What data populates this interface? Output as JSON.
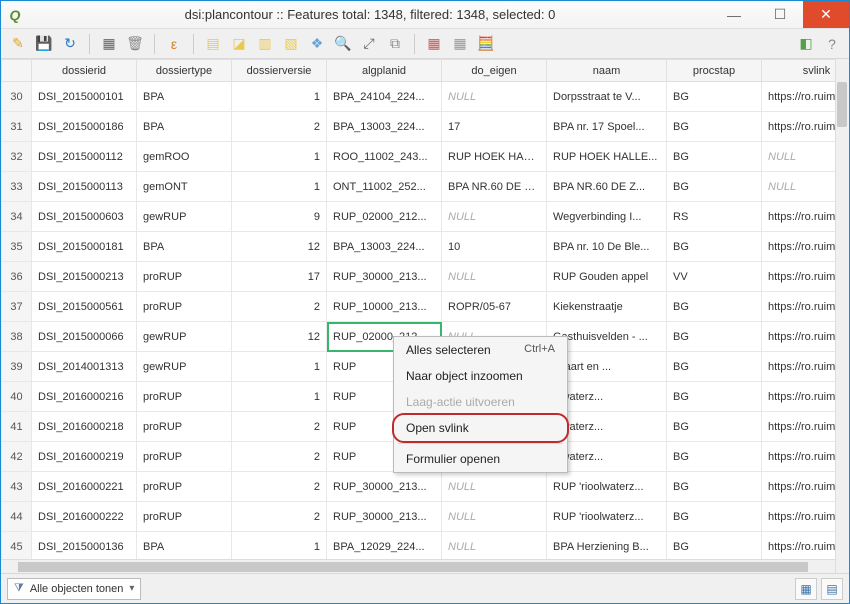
{
  "window": {
    "title": "dsi:plancontour :: Features total: 1348, filtered: 1348, selected: 0"
  },
  "columns": [
    "dossierid",
    "dossiertype",
    "dossierversie",
    "algplanid",
    "do_eigen",
    "naam",
    "procstap",
    "svlink"
  ],
  "rows": [
    {
      "n": "30",
      "dossierid": "DSI_2015000101",
      "dossiertype": "BPA",
      "dossierversie": "1",
      "algplanid": "BPA_24104_224...",
      "do_eigen": "NULL",
      "naam": "Dorpsstraat te V...",
      "procstap": "BG",
      "svlink": "https://ro.ruimte"
    },
    {
      "n": "31",
      "dossierid": "DSI_2015000186",
      "dossiertype": "BPA",
      "dossierversie": "2",
      "algplanid": "BPA_13003_224...",
      "do_eigen": "17",
      "naam": "BPA nr. 17 Spoel...",
      "procstap": "BG",
      "svlink": "https://ro.ruimte"
    },
    {
      "n": "32",
      "dossierid": "DSI_2015000112",
      "dossiertype": "gemROO",
      "dossierversie": "1",
      "algplanid": "ROO_11002_243...",
      "do_eigen": "RUP HOEK HALLE...",
      "naam": "RUP HOEK HALLE...",
      "procstap": "BG",
      "svlink": "NULL"
    },
    {
      "n": "33",
      "dossierid": "DSI_2015000113",
      "dossiertype": "gemONT",
      "dossierversie": "1",
      "algplanid": "ONT_11002_252...",
      "do_eigen": "BPA NR.60 DE Z...",
      "naam": "BPA NR.60 DE Z...",
      "procstap": "BG",
      "svlink": "NULL"
    },
    {
      "n": "34",
      "dossierid": "DSI_2015000603",
      "dossiertype": "gewRUP",
      "dossierversie": "9",
      "algplanid": "RUP_02000_212...",
      "do_eigen": "NULL",
      "naam": "Wegverbinding I...",
      "procstap": "RS",
      "svlink": "https://ro.ruimte"
    },
    {
      "n": "35",
      "dossierid": "DSI_2015000181",
      "dossiertype": "BPA",
      "dossierversie": "12",
      "algplanid": "BPA_13003_224...",
      "do_eigen": "10",
      "naam": "BPA nr. 10 De Ble...",
      "procstap": "BG",
      "svlink": "https://ro.ruimte"
    },
    {
      "n": "36",
      "dossierid": "DSI_2015000213",
      "dossiertype": "proRUP",
      "dossierversie": "17",
      "algplanid": "RUP_30000_213...",
      "do_eigen": "NULL",
      "naam": "RUP Gouden appel",
      "procstap": "VV",
      "svlink": "https://ro.ruimte"
    },
    {
      "n": "37",
      "dossierid": "DSI_2015000561",
      "dossiertype": "proRUP",
      "dossierversie": "2",
      "algplanid": "RUP_10000_213...",
      "do_eigen": "ROPR/05-67",
      "naam": "Kiekenstraatje",
      "procstap": "BG",
      "svlink": "https://ro.ruimte"
    },
    {
      "n": "38",
      "dossierid": "DSI_2015000066",
      "dossiertype": "gewRUP",
      "dossierversie": "12",
      "algplanid": "RUP_02000_212...",
      "do_eigen": "NULL",
      "naam": "Gasthuisvelden - ...",
      "procstap": "BG",
      "svlink": "https://ro.ruimte"
    },
    {
      "n": "39",
      "dossierid": "DSI_2014001313",
      "dossiertype": "gewRUP",
      "dossierversie": "1",
      "algplanid": "RUP",
      "do_eigen": "",
      "naam": "nkaart en ...",
      "procstap": "BG",
      "svlink": "https://ro.ruimte"
    },
    {
      "n": "40",
      "dossierid": "DSI_2016000216",
      "dossiertype": "proRUP",
      "dossierversie": "1",
      "algplanid": "RUP",
      "do_eigen": "",
      "naam": "olwaterz...",
      "procstap": "BG",
      "svlink": "https://ro.ruimte"
    },
    {
      "n": "41",
      "dossierid": "DSI_2016000218",
      "dossiertype": "proRUP",
      "dossierversie": "2",
      "algplanid": "RUP",
      "do_eigen": "",
      "naam": "olwaterz...",
      "procstap": "BG",
      "svlink": "https://ro.ruimte"
    },
    {
      "n": "42",
      "dossierid": "DSI_2016000219",
      "dossiertype": "proRUP",
      "dossierversie": "2",
      "algplanid": "RUP",
      "do_eigen": "",
      "naam": "olwaterz...",
      "procstap": "BG",
      "svlink": "https://ro.ruimte"
    },
    {
      "n": "43",
      "dossierid": "DSI_2016000221",
      "dossiertype": "proRUP",
      "dossierversie": "2",
      "algplanid": "RUP_30000_213...",
      "do_eigen": "NULL",
      "naam": "RUP 'rioolwaterz...",
      "procstap": "BG",
      "svlink": "https://ro.ruimte"
    },
    {
      "n": "44",
      "dossierid": "DSI_2016000222",
      "dossiertype": "proRUP",
      "dossierversie": "2",
      "algplanid": "RUP_30000_213...",
      "do_eigen": "NULL",
      "naam": "RUP 'rioolwaterz...",
      "procstap": "BG",
      "svlink": "https://ro.ruimte"
    },
    {
      "n": "45",
      "dossierid": "DSI_2015000136",
      "dossiertype": "BPA",
      "dossierversie": "1",
      "algplanid": "BPA_12029_224...",
      "do_eigen": "NULL",
      "naam": "BPA Herziening B...",
      "procstap": "BG",
      "svlink": "https://ro.ruimte"
    }
  ],
  "selected_cell": {
    "row": 8,
    "col": "algplanid"
  },
  "context_menu": {
    "items": [
      {
        "label": "Alles selecteren",
        "kbd": "Ctrl+A",
        "disabled": false
      },
      {
        "label": "Naar object inzoomen",
        "disabled": false
      },
      {
        "label": "Laag-actie uitvoeren",
        "disabled": true
      },
      {
        "label": "Open svlink",
        "disabled": false,
        "highlight": true
      },
      {
        "sep": true
      },
      {
        "label": "Formulier openen",
        "disabled": false
      }
    ]
  },
  "footer": {
    "filter_label": "Alle objecten tonen"
  }
}
